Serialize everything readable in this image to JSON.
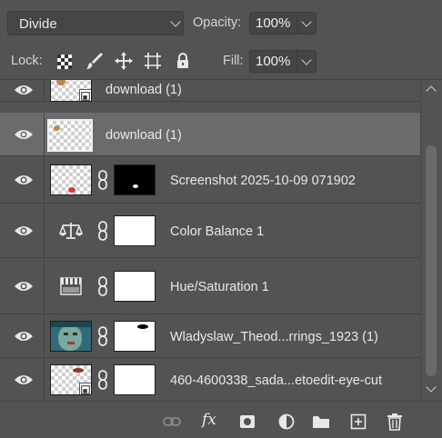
{
  "blend_mode": "Divide",
  "opacity": {
    "label": "Opacity:",
    "value": "100%"
  },
  "lock": {
    "label": "Lock:"
  },
  "fill": {
    "label": "Fill:",
    "value": "100%"
  },
  "layers": [
    {
      "name": "download (1)",
      "type": "smart-object",
      "selected": false
    },
    {
      "name": "download (1)",
      "type": "pixel",
      "selected": true
    },
    {
      "name": "Screenshot 2025-10-09 071902",
      "type": "pixel-with-mask",
      "selected": false
    },
    {
      "name": "Color Balance 1",
      "type": "adjustment-color-balance",
      "selected": false
    },
    {
      "name": "Hue/Saturation 1",
      "type": "adjustment-hue-saturation",
      "selected": false
    },
    {
      "name": "Wladyslaw_Theod...rrings_1923 (1)",
      "type": "pixel-with-mask",
      "selected": false
    },
    {
      "name": "460-4600338_sada...etoedit-eye-cut",
      "type": "smart-object-with-mask",
      "selected": false
    }
  ],
  "bottom_icons": [
    "link-layers-icon",
    "fx-icon",
    "add-mask-icon",
    "adjustment-layer-icon",
    "group-folder-icon",
    "new-layer-icon",
    "delete-icon"
  ],
  "fx_label": "fx"
}
